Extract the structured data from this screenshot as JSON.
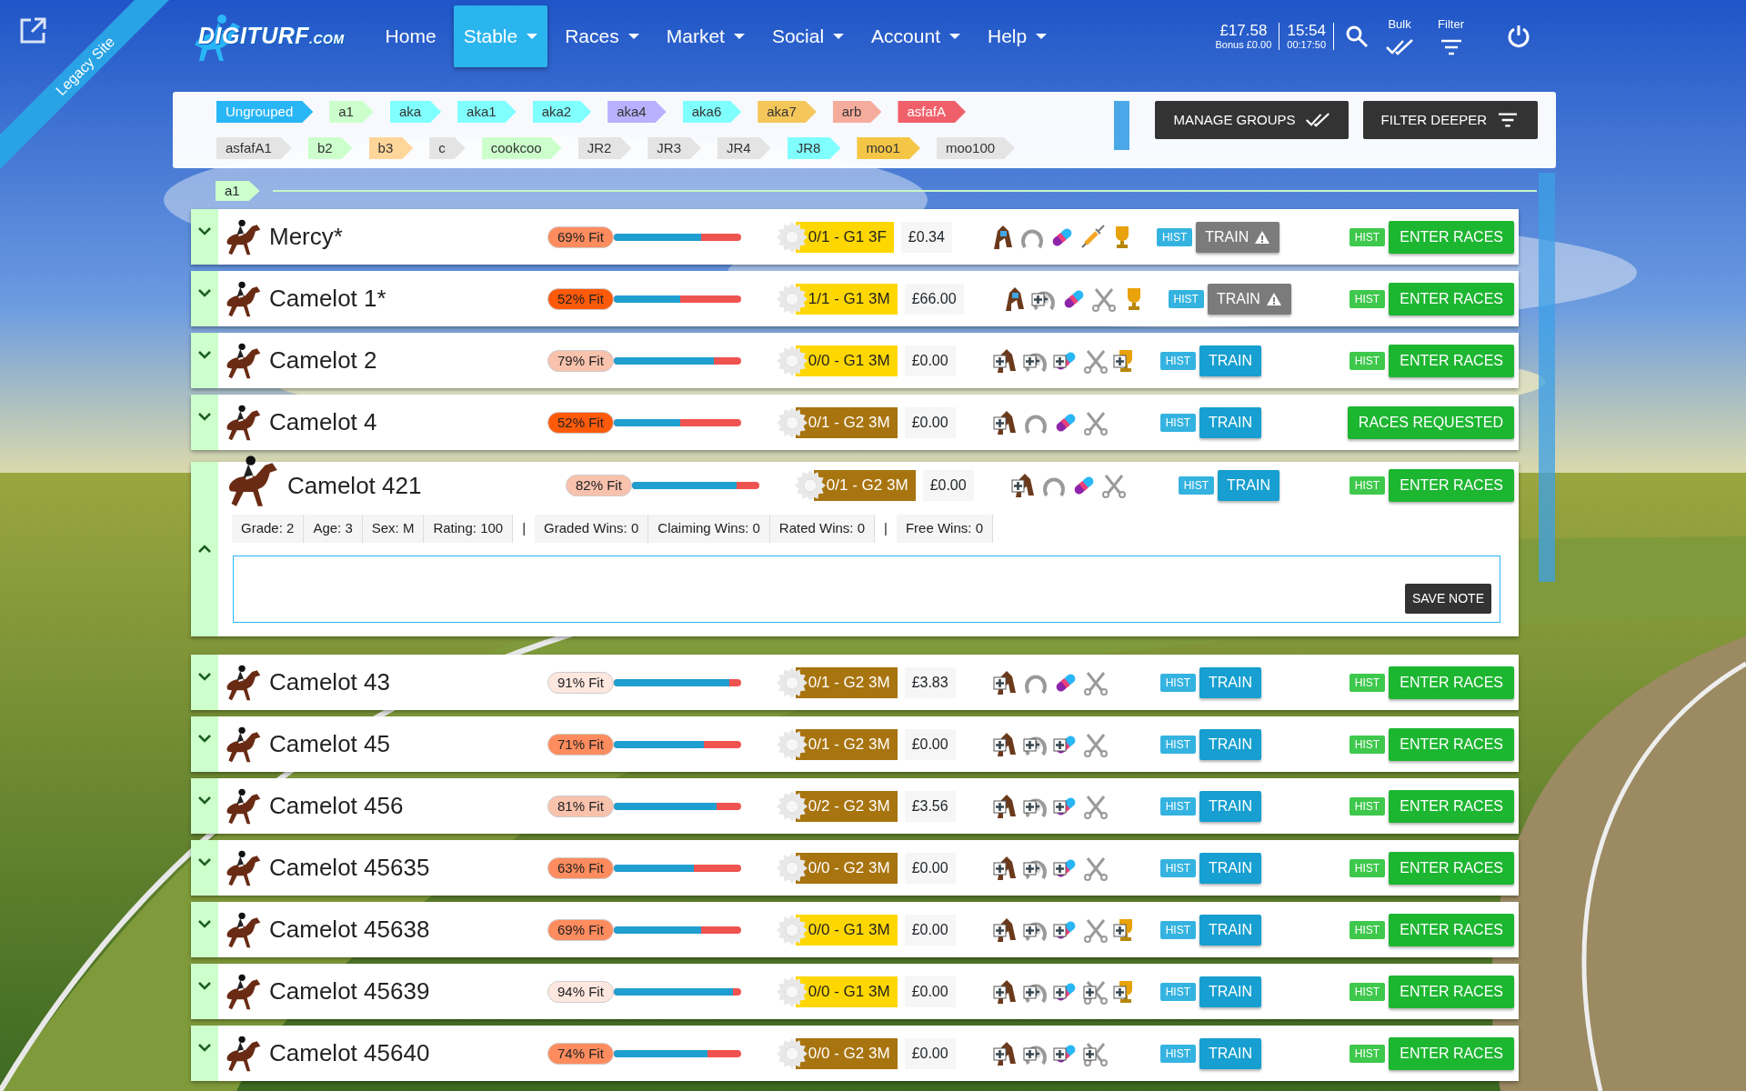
{
  "header": {
    "ribbon": "Legacy Site",
    "logo": {
      "main": "DIGITURF",
      "suffix": ".COM"
    },
    "nav": [
      {
        "label": "Home",
        "dropdown": false,
        "selected": false
      },
      {
        "label": "Stable",
        "dropdown": true,
        "selected": true
      },
      {
        "label": "Races",
        "dropdown": true,
        "selected": false
      },
      {
        "label": "Market",
        "dropdown": true,
        "selected": false
      },
      {
        "label": "Social",
        "dropdown": true,
        "selected": false
      },
      {
        "label": "Account",
        "dropdown": true,
        "selected": false
      },
      {
        "label": "Help",
        "dropdown": true,
        "selected": false
      }
    ],
    "balance": "£17.58",
    "bonus": "Bonus £0.00",
    "clock": "15:54",
    "timer": "00:17:50",
    "bulk": "Bulk",
    "filter": "Filter"
  },
  "groups": {
    "tags": [
      {
        "label": "Ungrouped",
        "color": "#29b6f6"
      },
      {
        "label": "a1",
        "color": "#ccffcc"
      },
      {
        "label": "aka",
        "color": "#80ffff"
      },
      {
        "label": "aka1",
        "color": "#80ffff"
      },
      {
        "label": "aka2",
        "color": "#80ffff"
      },
      {
        "label": "aka4",
        "color": "#b9b0ff"
      },
      {
        "label": "aka6",
        "color": "#80ffff"
      },
      {
        "label": "aka7",
        "color": "#f5c659"
      },
      {
        "label": "arb",
        "color": "#f6ac9c"
      },
      {
        "label": "asfafA",
        "color": "#f0606a"
      },
      {
        "label": "asfafA1",
        "color": "#e4e4e4"
      },
      {
        "label": "b2",
        "color": "#ccffcc"
      },
      {
        "label": "b3",
        "color": "#ffd699"
      },
      {
        "label": "c",
        "color": "#e4e4e4"
      },
      {
        "label": "cookcoo",
        "color": "#ccffcc"
      },
      {
        "label": "JR2",
        "color": "#e4e4e4"
      },
      {
        "label": "JR3",
        "color": "#e4e4e4"
      },
      {
        "label": "JR4",
        "color": "#e4e4e4"
      },
      {
        "label": "JR8",
        "color": "#80ffff"
      },
      {
        "label": "moo1",
        "color": "#f5c645"
      },
      {
        "label": "moo100",
        "color": "#e4e4e4"
      }
    ],
    "manage": "MANAGE GROUPS",
    "filter_deeper": "FILTER DEEPER"
  },
  "group_header": {
    "label": "a1",
    "color": "#ccffcc"
  },
  "rows": [
    {
      "name": "Mercy*",
      "fit": "69% Fit",
      "level": 0.69,
      "grade": {
        "text": "0/1 - G1 3F",
        "color": "#ffd700"
      },
      "money": "£0.34",
      "gear": [
        {
          "kind": "head",
          "plus": false
        },
        {
          "kind": "shoe",
          "plus": false
        },
        {
          "kind": "pill",
          "plus": false
        },
        {
          "kind": "syringe",
          "plus": false
        },
        {
          "kind": "trophy",
          "plus": false
        }
      ],
      "hist_1": "HIST",
      "train": "TRAIN",
      "train_warning": true,
      "hist_2": "HIST",
      "races": "ENTER RACES",
      "expanded": false
    },
    {
      "name": "Camelot 1*",
      "fit": "52% Fit",
      "level": 0.52,
      "grade": {
        "text": "1/1 - G1 3M",
        "color": "#ffd700"
      },
      "money": "£66.00",
      "gear": [
        {
          "kind": "head",
          "plus": false
        },
        {
          "kind": "shoe",
          "plus": true
        },
        {
          "kind": "pill",
          "plus": false
        },
        {
          "kind": "scissors",
          "plus": false
        },
        {
          "kind": "trophy",
          "plus": false
        }
      ],
      "hist_1": "HIST",
      "train": "TRAIN",
      "train_warning": true,
      "hist_2": "HIST",
      "races": "ENTER RACES",
      "expanded": false
    },
    {
      "name": "Camelot 2",
      "fit": "79% Fit",
      "level": 0.79,
      "grade": {
        "text": "0/0 - G1 3M",
        "color": "#ffd700"
      },
      "money": "£0.00",
      "gear": [
        {
          "kind": "head",
          "plus": true
        },
        {
          "kind": "shoe",
          "plus": true
        },
        {
          "kind": "pill",
          "plus": true
        },
        {
          "kind": "scissors",
          "plus": false
        },
        {
          "kind": "trophy",
          "plus": true
        }
      ],
      "hist_1": "HIST",
      "train": "TRAIN",
      "train_warning": false,
      "hist_2": "HIST",
      "races": "ENTER RACES",
      "expanded": false
    },
    {
      "name": "Camelot 4",
      "fit": "52% Fit",
      "level": 0.52,
      "grade": {
        "text": "0/1 - G2 3M",
        "color": "#a8740f"
      },
      "money": "£0.00",
      "gear": [
        {
          "kind": "head",
          "plus": true
        },
        {
          "kind": "shoe",
          "plus": false
        },
        {
          "kind": "pill",
          "plus": false
        },
        {
          "kind": "scissors",
          "plus": false
        }
      ],
      "hist_1": "HIST",
      "train": "TRAIN",
      "train_warning": false,
      "races": "RACES REQUESTED",
      "expanded": false
    },
    {
      "name": "Camelot 421",
      "fit": "82% Fit",
      "level": 0.82,
      "grade": {
        "text": "0/1 - G2 3M",
        "color": "#a8740f"
      },
      "money": "£0.00",
      "gear": [
        {
          "kind": "head",
          "plus": true
        },
        {
          "kind": "shoe",
          "plus": false
        },
        {
          "kind": "pill",
          "plus": false
        },
        {
          "kind": "scissors",
          "plus": false
        }
      ],
      "hist_1": "HIST",
      "train": "TRAIN",
      "train_warning": false,
      "hist_2": "HIST",
      "races": "ENTER RACES",
      "expanded": true,
      "stats": [
        {
          "kind": "stat",
          "text": "Grade: 2"
        },
        {
          "kind": "stat",
          "text": "Age: 3"
        },
        {
          "kind": "stat",
          "text": "Sex: M"
        },
        {
          "kind": "stat",
          "text": "Rating: 100"
        },
        {
          "kind": "separator",
          "text": "|"
        },
        {
          "kind": "stat",
          "text": "Graded Wins: 0"
        },
        {
          "kind": "stat",
          "text": "Claiming Wins: 0"
        },
        {
          "kind": "stat",
          "text": "Rated Wins: 0"
        },
        {
          "kind": "separator",
          "text": "|"
        },
        {
          "kind": "stat",
          "text": "Free Wins: 0"
        }
      ],
      "save_note": "SAVE NOTE"
    },
    {
      "name": "Camelot 43",
      "fit": "91% Fit",
      "level": 0.91,
      "grade": {
        "text": "0/1 - G2 3M",
        "color": "#a8740f"
      },
      "money": "£3.83",
      "gear": [
        {
          "kind": "head",
          "plus": true
        },
        {
          "kind": "shoe",
          "plus": false
        },
        {
          "kind": "pill",
          "plus": false
        },
        {
          "kind": "scissors",
          "plus": false
        }
      ],
      "hist_1": "HIST",
      "train": "TRAIN",
      "train_warning": false,
      "hist_2": "HIST",
      "races": "ENTER RACES",
      "expanded": false
    },
    {
      "name": "Camelot 45",
      "fit": "71% Fit",
      "level": 0.71,
      "grade": {
        "text": "0/1 - G2 3M",
        "color": "#a8740f"
      },
      "money": "£0.00",
      "gear": [
        {
          "kind": "head",
          "plus": true
        },
        {
          "kind": "shoe",
          "plus": true
        },
        {
          "kind": "pill",
          "plus": true
        },
        {
          "kind": "scissors",
          "plus": false
        }
      ],
      "hist_1": "HIST",
      "train": "TRAIN",
      "train_warning": false,
      "hist_2": "HIST",
      "races": "ENTER RACES",
      "expanded": false
    },
    {
      "name": "Camelot 456",
      "fit": "81% Fit",
      "level": 0.81,
      "grade": {
        "text": "0/2 - G2 3M",
        "color": "#a8740f"
      },
      "money": "£3.56",
      "gear": [
        {
          "kind": "head",
          "plus": true
        },
        {
          "kind": "shoe",
          "plus": true
        },
        {
          "kind": "pill",
          "plus": true
        },
        {
          "kind": "scissors",
          "plus": false
        }
      ],
      "hist_1": "HIST",
      "train": "TRAIN",
      "train_warning": false,
      "hist_2": "HIST",
      "races": "ENTER RACES",
      "expanded": false
    },
    {
      "name": "Camelot 45635",
      "fit": "63% Fit",
      "level": 0.63,
      "grade": {
        "text": "0/0 - G2 3M",
        "color": "#a8740f"
      },
      "money": "£0.00",
      "gear": [
        {
          "kind": "head",
          "plus": true
        },
        {
          "kind": "shoe",
          "plus": true
        },
        {
          "kind": "pill",
          "plus": true
        },
        {
          "kind": "scissors",
          "plus": false
        }
      ],
      "hist_1": "HIST",
      "train": "TRAIN",
      "train_warning": false,
      "hist_2": "HIST",
      "races": "ENTER RACES",
      "expanded": false
    },
    {
      "name": "Camelot 45638",
      "fit": "69% Fit",
      "level": 0.69,
      "grade": {
        "text": "0/0 - G1 3M",
        "color": "#ffd700"
      },
      "money": "£0.00",
      "gear": [
        {
          "kind": "head",
          "plus": true
        },
        {
          "kind": "shoe",
          "plus": true
        },
        {
          "kind": "pill",
          "plus": true
        },
        {
          "kind": "scissors",
          "plus": false
        },
        {
          "kind": "trophy",
          "plus": true
        }
      ],
      "hist_1": "HIST",
      "train": "TRAIN",
      "train_warning": false,
      "hist_2": "HIST",
      "races": "ENTER RACES",
      "expanded": false
    },
    {
      "name": "Camelot 45639",
      "fit": "94% Fit",
      "level": 0.94,
      "grade": {
        "text": "0/0 - G1 3M",
        "color": "#ffd700"
      },
      "money": "£0.00",
      "gear": [
        {
          "kind": "head",
          "plus": true
        },
        {
          "kind": "shoe",
          "plus": true
        },
        {
          "kind": "pill",
          "plus": true
        },
        {
          "kind": "scissors",
          "plus": true
        },
        {
          "kind": "trophy",
          "plus": true
        }
      ],
      "hist_1": "HIST",
      "train": "TRAIN",
      "train_warning": false,
      "hist_2": "HIST",
      "races": "ENTER RACES",
      "expanded": false
    },
    {
      "name": "Camelot 45640",
      "fit": "74% Fit",
      "level": 0.74,
      "grade": {
        "text": "0/0 - G2 3M",
        "color": "#a8740f"
      },
      "money": "£0.00",
      "gear": [
        {
          "kind": "head",
          "plus": true
        },
        {
          "kind": "shoe",
          "plus": true
        },
        {
          "kind": "pill",
          "plus": true
        },
        {
          "kind": "scissors",
          "plus": true
        }
      ],
      "hist_1": "HIST",
      "train": "TRAIN",
      "train_warning": false,
      "hist_2": "HIST",
      "races": "ENTER RACES",
      "expanded": false
    }
  ]
}
